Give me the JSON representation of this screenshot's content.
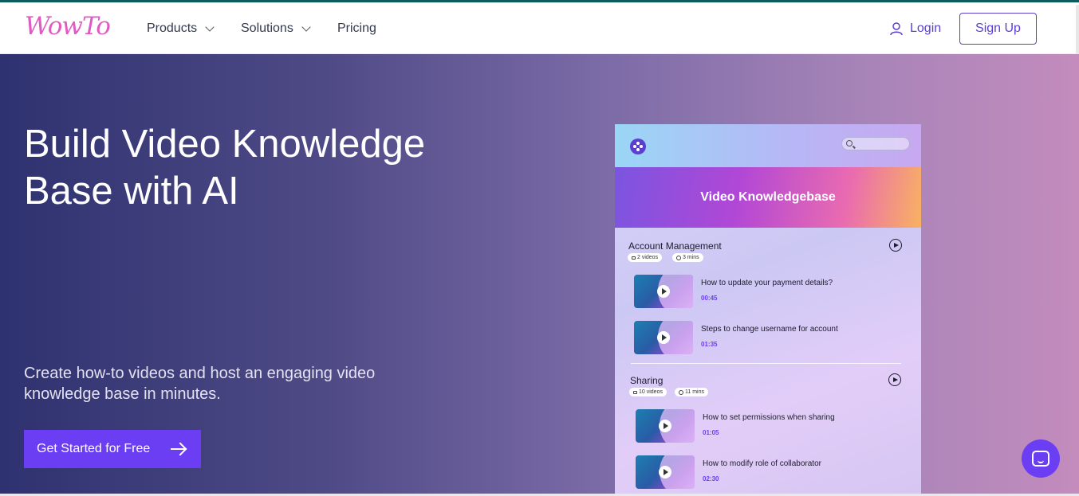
{
  "nav": {
    "logo": "WowTo",
    "items": [
      {
        "label": "Products",
        "dropdown": true
      },
      {
        "label": "Solutions",
        "dropdown": true
      },
      {
        "label": "Pricing",
        "dropdown": false
      }
    ],
    "login": "Login",
    "signup": "Sign Up"
  },
  "hero": {
    "title": "Build Video Knowledge Base with AI",
    "subtitle": "Create how-to videos and host an engaging video knowledge base in minutes.",
    "cta": "Get Started for Free"
  },
  "mock": {
    "banner_title": "Video Knowledgebase",
    "sections": [
      {
        "title": "Account Management",
        "videos_count": "2 videos",
        "duration": "3 mins",
        "videos": [
          {
            "title": "How to update your payment details?",
            "duration": "00:45"
          },
          {
            "title": "Steps to change username for account",
            "duration": "01:35"
          }
        ]
      },
      {
        "title": "Sharing",
        "videos_count": "10 videos",
        "duration": "11 mins",
        "videos": [
          {
            "title": "How to set permissions when sharing",
            "duration": "01:05"
          },
          {
            "title": "How to modify role of collaborator",
            "duration": "02:30"
          }
        ]
      }
    ]
  },
  "colors": {
    "brand": "#6b3ef3",
    "logo": "#e05ac3",
    "nav_accent": "#5b3fd1"
  },
  "icons": [
    "user-icon",
    "chevron-down-icon",
    "arrow-right-icon",
    "search-icon",
    "play-icon",
    "video-icon",
    "clock-icon",
    "chat-icon"
  ]
}
